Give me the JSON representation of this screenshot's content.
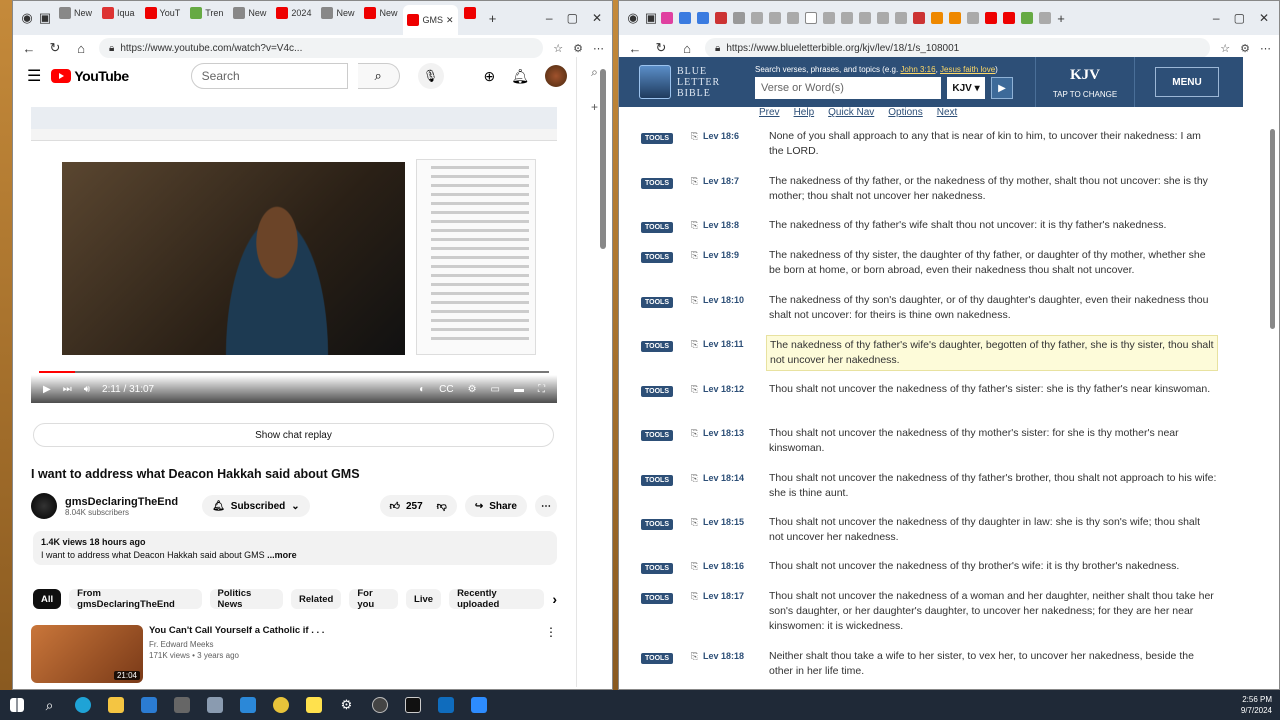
{
  "left_window": {
    "tabs": [
      {
        "label": "New",
        "color": "#888"
      },
      {
        "label": "Iqua",
        "color": "#d33"
      },
      {
        "label": "YouT",
        "color": "#e00"
      },
      {
        "label": "Tren",
        "color": "#6a4"
      },
      {
        "label": "New",
        "color": "#888"
      },
      {
        "label": "2024",
        "color": "#e00"
      },
      {
        "label": "New",
        "color": "#888"
      },
      {
        "label": "New",
        "color": "#e00"
      },
      {
        "label": "GMS",
        "color": "#e00"
      },
      {
        "label": "",
        "color": "#e00"
      }
    ],
    "url": "https://www.youtube.com/watch?v=V4c...",
    "search_placeholder": "Search",
    "logo_text": "YouTube",
    "time": "2:11 / 31:07",
    "progress_fraction": 0.07,
    "show_chat_replay": "Show chat replay",
    "video_title": "I want to address what Deacon Hakkah said about GMS",
    "channel_name": "gmsDeclaringTheEnd",
    "subscribers": "8.04K subscribers",
    "subscribed": "Subscribed",
    "likes": "257",
    "share": "Share",
    "views_line": "1.4K views  18 hours ago",
    "desc_line": "I want to address what Deacon Hakkah said about GMS",
    "more": "...more",
    "chips": [
      "All",
      "From gmsDeclaringTheEnd",
      "Politics News",
      "Related",
      "For you",
      "Live",
      "Recently uploaded"
    ],
    "rec": {
      "title": "You Can't Call Yourself a Catholic if . . .",
      "channel": "Fr. Edward Meeks",
      "meta": "171K views  • 3 years ago",
      "duration": "21:04"
    }
  },
  "right_window": {
    "url": "https://www.blueletterbible.org/kjv/lev/18/1/s_108001",
    "logo_lines": [
      "BLUE",
      "LETTER",
      "BIBLE"
    ],
    "search_hint_prefix": "Search verses, phrases, and topics (e.g.",
    "search_hint_ex1": "John 3:16",
    "search_hint_ex2": "Jesus faith love",
    "verse_placeholder": "Verse or Word(s)",
    "version": "KJV",
    "version_title": "KJV",
    "tap_to_change": "TAP TO CHANGE",
    "menu": "MENU",
    "nav": [
      "Prev",
      "Help",
      "Quick Nav",
      "Options",
      "Next"
    ],
    "tools_label": "TOOLS",
    "verses": [
      {
        "ref": "Lev 18:6",
        "text": "None of you shall approach to any that is near of kin to him, to uncover their nakedness: I am the LORD."
      },
      {
        "ref": "Lev 18:7",
        "text": "The nakedness of thy father, or the nakedness of thy mother, shalt thou not uncover: she is thy mother; thou shalt not uncover her nakedness."
      },
      {
        "ref": "Lev 18:8",
        "text": "The nakedness of thy father's wife shalt thou not uncover: it is thy father's nakedness."
      },
      {
        "ref": "Lev 18:9",
        "text": "The nakedness of thy sister, the daughter of thy father, or daughter of thy mother, whether she be born at home, or born abroad, even their nakedness thou shalt not uncover."
      },
      {
        "ref": "Lev 18:10",
        "text": "The nakedness of thy son's daughter, or of thy daughter's daughter, even their nakedness thou shalt not uncover: for theirs is thine own nakedness."
      },
      {
        "ref": "Lev 18:11",
        "text": "The nakedness of thy father's wife's daughter, begotten of thy father, she is thy sister, thou shalt not uncover her nakedness."
      },
      {
        "ref": "Lev 18:12",
        "text": "Thou shalt not uncover the nakedness of thy father's sister: she is thy father's near kinswoman."
      },
      {
        "ref": "Lev 18:13",
        "text": "Thou shalt not uncover the nakedness of thy mother's sister: for she is thy mother's near kinswoman."
      },
      {
        "ref": "Lev 18:14",
        "text": "Thou shalt not uncover the nakedness of thy father's brother, thou shalt not approach to his wife: she is thine aunt."
      },
      {
        "ref": "Lev 18:15",
        "text": "Thou shalt not uncover the nakedness of thy daughter in law: she is thy son's wife; thou shalt not uncover her nakedness."
      },
      {
        "ref": "Lev 18:16",
        "text": "Thou shalt not uncover the nakedness of thy brother's wife: it is thy brother's nakedness."
      },
      {
        "ref": "Lev 18:17",
        "text": "Thou shalt not uncover the nakedness of a woman and her daughter, neither shalt thou take her son's daughter, or her daughter's daughter, to uncover her nakedness; for they are her near kinswomen: it is wickedness."
      },
      {
        "ref": "Lev 18:18",
        "text": "Neither shalt thou take a wife to her sister, to vex her, to uncover her nakedness, beside the other in her life time."
      }
    ]
  },
  "taskbar": {
    "time": "2:56 PM",
    "date": "9/7/2024"
  },
  "colors": {
    "blb_blue": "#2d4f77",
    "youtube_red": "#ff0000"
  }
}
